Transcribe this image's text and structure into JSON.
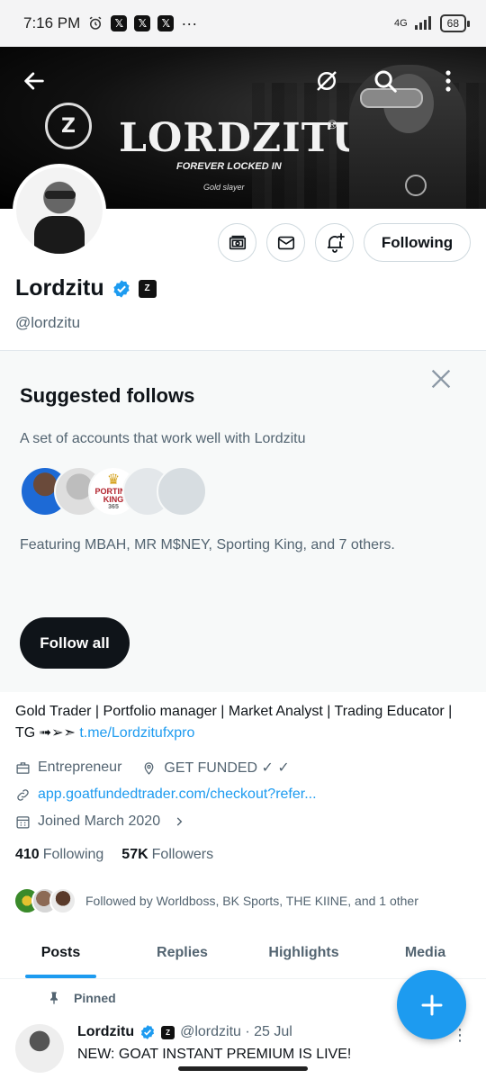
{
  "status_bar": {
    "time": "7:16 PM",
    "network": "4G",
    "battery": "68"
  },
  "banner": {
    "brand": "LORDZITU",
    "brand_mark": "®",
    "tagline": "FOREVER LOCKED IN",
    "subtitle": "Gold slayer"
  },
  "profile": {
    "display_name": "Lordzitu",
    "handle": "@lordzitu",
    "follow_button": "Following"
  },
  "suggested": {
    "title": "Suggested follows",
    "description": "A set of accounts that work well with Lordzitu",
    "featuring": "Featuring MBAH, MR M$NEY, Sporting King, and 7 others.",
    "avatar3_text": [
      "PORTING",
      "KING",
      "365"
    ],
    "follow_all": "Follow all"
  },
  "bio": {
    "text": "Gold Trader | Portfolio manager | Market Analyst | Trading Educator | TG ➟➢➣ ",
    "link": "t.me/Lordzitufxpro",
    "profession": "Entrepreneur",
    "location": "GET FUNDED ✓ ✓",
    "website": "app.goatfundedtrader.com/checkout?refer...",
    "joined": "Joined March 2020"
  },
  "stats": {
    "following_count": "410",
    "following_label": "Following",
    "followers_count": "57K",
    "followers_label": "Followers"
  },
  "followed_by": "Followed by Worldboss, BK Sports, THE KIINE, and 1 other",
  "tabs": [
    "Posts",
    "Replies",
    "Highlights",
    "Media"
  ],
  "pinned_post": {
    "pinned_label": "Pinned",
    "author": "Lordzitu",
    "handle_date": "@lordzitu · 25 Jul",
    "text": "NEW: GOAT INSTANT PREMIUM IS LIVE!"
  },
  "colors": {
    "accent": "#1d9bf0",
    "text": "#0f1419",
    "muted": "#536471"
  }
}
